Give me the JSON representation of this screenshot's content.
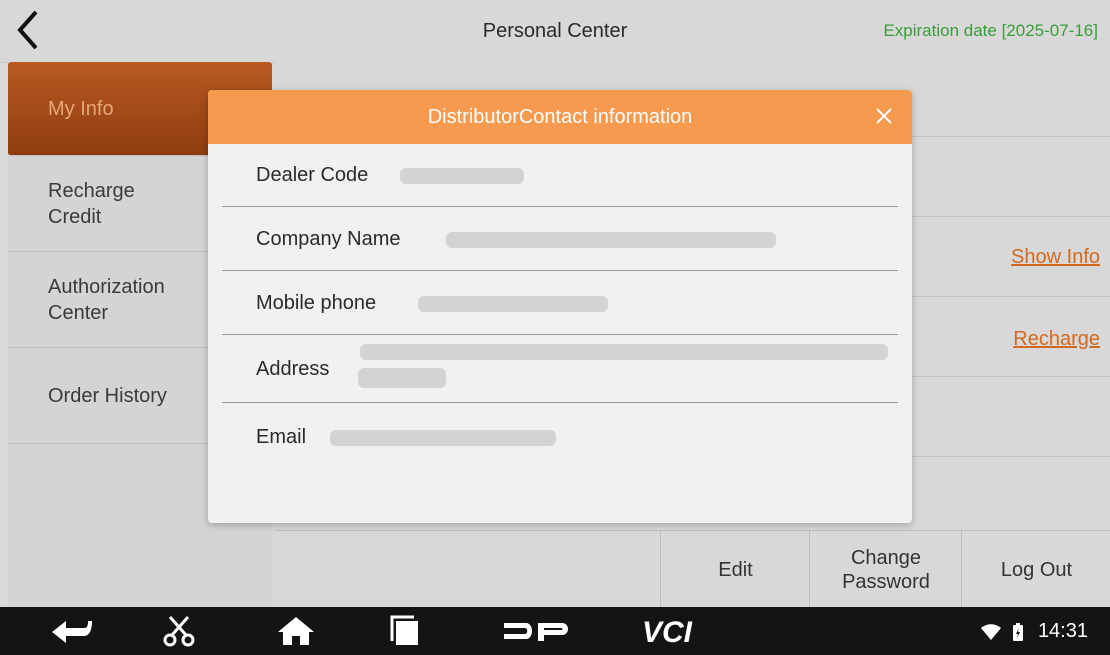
{
  "header": {
    "title": "Personal Center",
    "expiration": "Expiration date [2025-07-16]"
  },
  "sidebar": {
    "items": [
      {
        "label": "My Info"
      },
      {
        "label": "Recharge\nCredit"
      },
      {
        "label": "Authorization\nCenter"
      },
      {
        "label": "Order History"
      }
    ]
  },
  "main": {
    "show_info_link": "Show Info",
    "recharge_link": "Recharge"
  },
  "bottom_bar": {
    "edit": "Edit",
    "change_password": "Change\nPassword",
    "logout": "Log Out"
  },
  "dialog": {
    "title": "DistributorContact information",
    "fields": {
      "dealer_code": "Dealer Code",
      "company_name": "Company Name",
      "mobile_phone": "Mobile phone",
      "address": "Address",
      "email": "Email"
    }
  },
  "status_bar": {
    "time": "14:31"
  },
  "icons": {
    "back": "back-arrow-icon",
    "close": "close-icon",
    "nav_back": "nav-back-icon",
    "scissors": "scissors-icon",
    "home": "home-icon",
    "recents": "recents-icon",
    "dp_logo": "dp-logo-icon",
    "vci": "vci-icon",
    "wifi": "wifi-icon",
    "battery": "battery-icon"
  },
  "colors": {
    "accent": "#f59a4e",
    "active_tab": "#a54a18",
    "link": "#d2691e",
    "expiry": "#3a9c3a"
  }
}
